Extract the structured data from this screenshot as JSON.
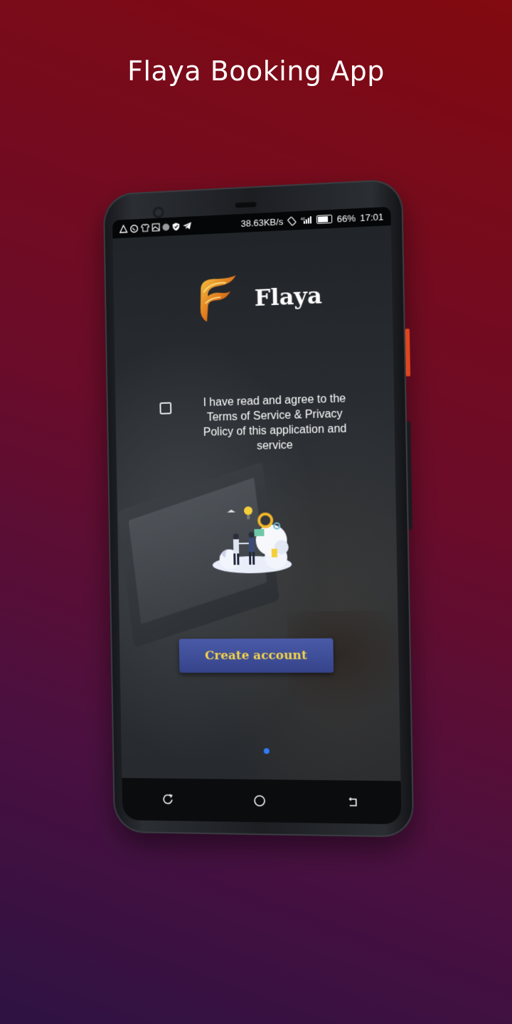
{
  "promo": {
    "title": "Flaya Booking App"
  },
  "status_bar": {
    "left_icons": [
      "warning-icon",
      "whatsapp-icon",
      "shirt-icon",
      "image-icon",
      "dot-icon",
      "shield-icon",
      "telegram-icon"
    ],
    "speed": "38.63KB/s",
    "battery": "66%",
    "time": "17:01"
  },
  "app": {
    "brand_name": "Flaya",
    "consent_text": "I have read and agree to the Terms of Service & Privacy Policy of this application and service",
    "consent_checked": false,
    "create_account_label": "Create account",
    "pagination": {
      "current": 1,
      "total": 1
    }
  },
  "colors": {
    "button_bg": "#3f4e99",
    "button_text": "#f4d44a",
    "active_dot": "#2f7cf5",
    "background_top": "#820a10",
    "background_bottom": "#2e1242"
  },
  "nav_bar": {
    "buttons": [
      "recent-apps-icon",
      "home-icon",
      "back-icon"
    ]
  }
}
